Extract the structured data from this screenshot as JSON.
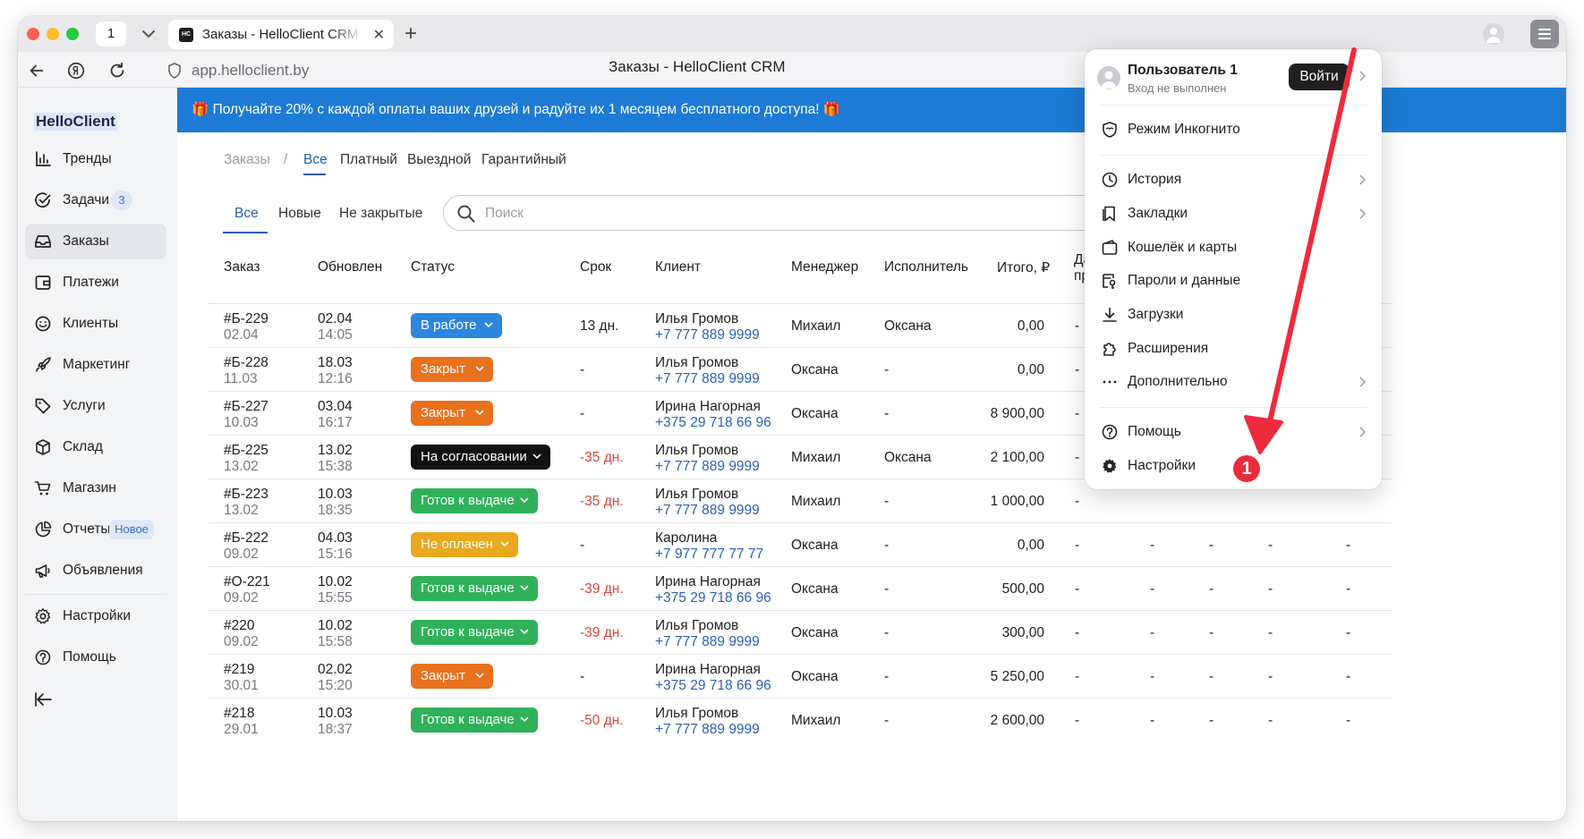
{
  "browser": {
    "tab_count": "1",
    "tab_title": "Заказы - HelloClient CRM",
    "favicon_text": "HC",
    "url": "app.helloclient.by",
    "page_title": "Заказы - HelloClient CRM"
  },
  "sidebar": {
    "logo": "HelloClient",
    "items": [
      {
        "label": "Тренды",
        "icon": "bar-chart-icon"
      },
      {
        "label": "Задачи",
        "icon": "check-circle-icon",
        "badge": "3"
      },
      {
        "label": "Заказы",
        "icon": "inbox-icon",
        "active": true
      },
      {
        "label": "Платежи",
        "icon": "wallet-icon"
      },
      {
        "label": "Клиенты",
        "icon": "smiley-icon"
      },
      {
        "label": "Маркетинг",
        "icon": "rocket-icon"
      },
      {
        "label": "Услуги",
        "icon": "tag-icon"
      },
      {
        "label": "Склад",
        "icon": "box-icon"
      },
      {
        "label": "Магазин",
        "icon": "cart-icon"
      },
      {
        "label": "Отчеты",
        "icon": "pie-chart-icon",
        "badge": "Новое"
      },
      {
        "label": "Объявления",
        "icon": "megaphone-icon"
      },
      {
        "label": "Настройки",
        "icon": "gear-icon"
      },
      {
        "label": "Помощь",
        "icon": "help-icon"
      }
    ]
  },
  "banner": {
    "text": "🎁 Получайте 20% с каждой оплаты ваших друзей и радуйте их 1 месяцем бесплатного доступа! 🎁"
  },
  "breadcrumb": {
    "root": "Заказы",
    "separator": "/",
    "tabs": [
      "Все",
      "Платный",
      "Выездной",
      "Гарантийный"
    ]
  },
  "filters": {
    "tabs": [
      "Все",
      "Новые",
      "Не закрытые"
    ],
    "search_placeholder": "Поиск"
  },
  "table": {
    "columns": [
      "Заказ",
      "Обновлен",
      "Статус",
      "Срок",
      "Клиент",
      "Менеджер",
      "Исполнитель",
      "Итого, ₽",
      "Дата прие"
    ],
    "status_colors": {
      "В работе": "#2d86de",
      "Закрыт": "#e8711e",
      "На согласовании": "#111111",
      "Готов к выдаче": "#2fb15a",
      "Не оплачен": "#e8a91e"
    },
    "rows": [
      {
        "id": "#Б-229",
        "created": "02.04",
        "upd_date": "02.04",
        "upd_time": "14:05",
        "status": "В работе",
        "term": "13 дн.",
        "overdue": false,
        "client": "Илья Громов",
        "phone": "+7 777 889 9999",
        "manager": "Михаил",
        "executor": "Оксана",
        "total": "0,00",
        "accept": "-"
      },
      {
        "id": "#Б-228",
        "created": "11.03",
        "upd_date": "18.03",
        "upd_time": "12:16",
        "status": "Закрыт",
        "term": "-",
        "overdue": false,
        "client": "Илья Громов",
        "phone": "+7 777 889 9999",
        "manager": "Оксана",
        "executor": "-",
        "total": "0,00",
        "accept": "-"
      },
      {
        "id": "#Б-227",
        "created": "10.03",
        "upd_date": "03.04",
        "upd_time": "16:17",
        "status": "Закрыт",
        "term": "-",
        "overdue": false,
        "client": "Ирина Нагорная",
        "phone": "+375 29 718 66 96",
        "manager": "Оксана",
        "executor": "-",
        "total": "8 900,00",
        "accept": "-"
      },
      {
        "id": "#Б-225",
        "created": "13.02",
        "upd_date": "13.02",
        "upd_time": "15:38",
        "status": "На согласовании",
        "term": "-35 дн.",
        "overdue": true,
        "client": "Илья Громов",
        "phone": "+7 777 889 9999",
        "manager": "Михаил",
        "executor": "Оксана",
        "total": "2 100,00",
        "accept": "-"
      },
      {
        "id": "#Б-223",
        "created": "13.02",
        "upd_date": "10.03",
        "upd_time": "18:35",
        "status": "Готов к выдаче",
        "term": "-35 дн.",
        "overdue": true,
        "client": "Илья Громов",
        "phone": "+7 777 889 9999",
        "manager": "Михаил",
        "executor": "-",
        "total": "1 000,00",
        "accept": "-"
      },
      {
        "id": "#Б-222",
        "created": "09.02",
        "upd_date": "04.03",
        "upd_time": "15:16",
        "status": "Не оплачен",
        "term": "-",
        "overdue": false,
        "client": "Каролина",
        "phone": "+7 977 777 77 77",
        "manager": "Оксана",
        "executor": "-",
        "total": "0,00",
        "accept": "-"
      },
      {
        "id": "#О-221",
        "created": "09.02",
        "upd_date": "10.02",
        "upd_time": "15:55",
        "status": "Готов к выдаче",
        "term": "-39 дн.",
        "overdue": true,
        "client": "Ирина Нагорная",
        "phone": "+375 29 718 66 96",
        "manager": "Оксана",
        "executor": "-",
        "total": "500,00",
        "accept": "-"
      },
      {
        "id": "#220",
        "created": "09.02",
        "upd_date": "10.02",
        "upd_time": "15:58",
        "status": "Готов к выдаче",
        "term": "-39 дн.",
        "overdue": true,
        "client": "Илья Громов",
        "phone": "+7 777 889 9999",
        "manager": "Оксана",
        "executor": "-",
        "total": "300,00",
        "accept": "-"
      },
      {
        "id": "#219",
        "created": "30.01",
        "upd_date": "02.02",
        "upd_time": "15:20",
        "status": "Закрыт",
        "term": "-",
        "overdue": false,
        "client": "Ирина Нагорная",
        "phone": "+375 29 718 66 96",
        "manager": "Оксана",
        "executor": "-",
        "total": "5 250,00",
        "accept": "-"
      },
      {
        "id": "#218",
        "created": "29.01",
        "upd_date": "10.03",
        "upd_time": "18:37",
        "status": "Готов к выдаче",
        "term": "-50 дн.",
        "overdue": true,
        "client": "Илья Громов",
        "phone": "+7 777 889 9999",
        "manager": "Михаил",
        "executor": "-",
        "total": "2 600,00",
        "accept": "-"
      }
    ],
    "hidden_dashes": "-"
  },
  "browser_menu": {
    "user_name": "Пользователь 1",
    "user_status": "Вход не выполнен",
    "login_label": "Войти",
    "items": [
      {
        "label": "Режим Инкогнито",
        "icon": "incognito-shield-icon",
        "chevron": false
      },
      {
        "label": "История",
        "icon": "history-clock-icon",
        "chevron": true
      },
      {
        "label": "Закладки",
        "icon": "bookmark-icon",
        "chevron": true
      },
      {
        "label": "Кошелёк и карты",
        "icon": "wallet-icon",
        "chevron": false
      },
      {
        "label": "Пароли и данные",
        "icon": "key-icon",
        "chevron": false
      },
      {
        "label": "Загрузки",
        "icon": "download-icon",
        "chevron": false
      },
      {
        "label": "Расширения",
        "icon": "puzzle-icon",
        "chevron": false
      },
      {
        "label": "Дополнительно",
        "icon": "more-dots-icon",
        "chevron": true
      },
      {
        "label": "Помощь",
        "icon": "help-icon",
        "chevron": true
      },
      {
        "label": "Настройки",
        "icon": "gear-icon",
        "chevron": false
      }
    ]
  },
  "annotation": {
    "number": "1",
    "color": "#ed2b3c"
  }
}
